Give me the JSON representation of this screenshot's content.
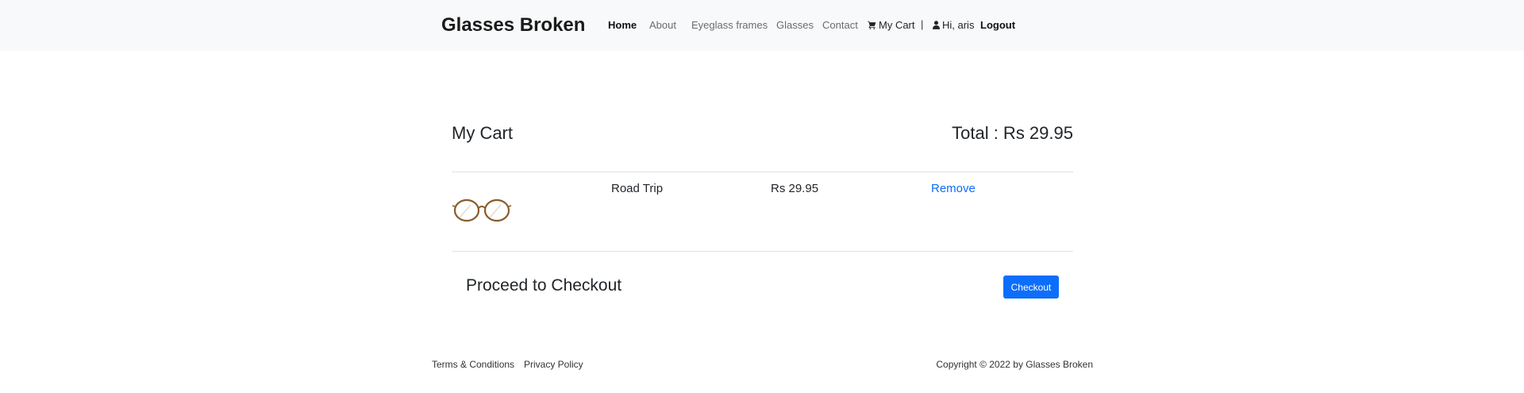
{
  "header": {
    "brand": "Glasses Broken",
    "nav": {
      "home": "Home",
      "about": "About",
      "eyeglass_frames": "Eyeglass frames",
      "glasses": "Glasses",
      "contact": "Contact",
      "my_cart": "My Cart",
      "separator": "|",
      "greeting": "Hi, aris",
      "logout": "Logout"
    },
    "icons": {
      "cart": "shopping-cart-icon",
      "user": "user-icon"
    }
  },
  "cart": {
    "title": "My Cart",
    "total": "Total : Rs 29.95",
    "items": [
      {
        "image": "eyeglasses-thumbnail",
        "name": "Road Trip",
        "price": "Rs 29.95",
        "remove_label": "Remove"
      }
    ]
  },
  "checkout": {
    "title": "Proceed to Checkout",
    "button_label": "Checkout"
  },
  "footer": {
    "terms": "Terms & Conditions",
    "privacy": "Privacy Policy",
    "copyright": "Copyright © 2022 by Glasses Broken"
  },
  "colors": {
    "navbar_bg": "#f8f9fa",
    "link_blue": "#0d6efd",
    "button_bg": "#0d6efd"
  }
}
